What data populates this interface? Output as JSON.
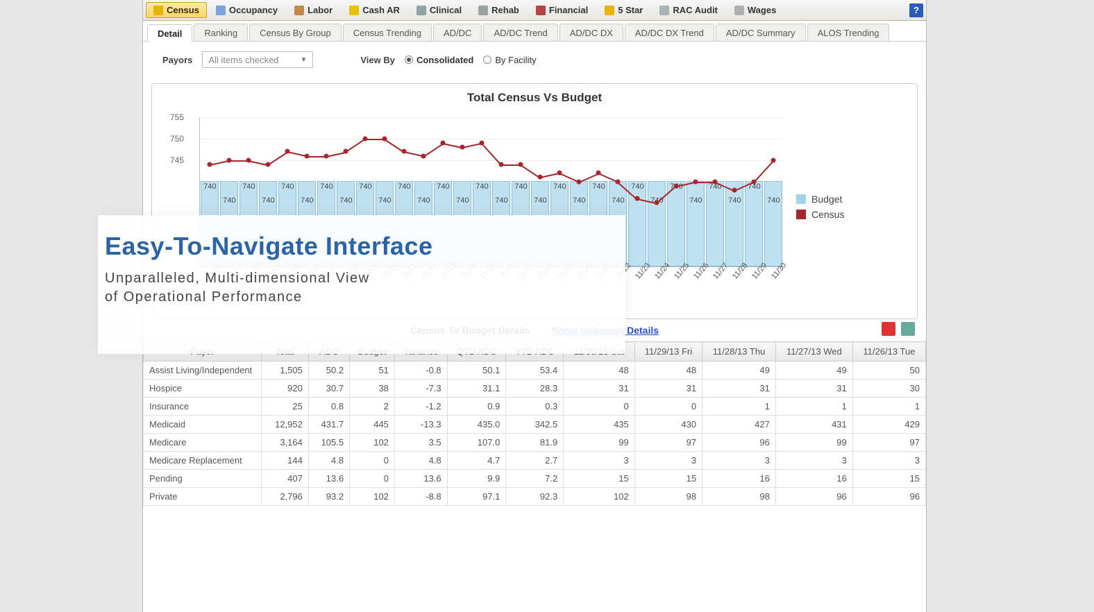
{
  "toolbar": {
    "items": [
      {
        "label": "Census",
        "active": true,
        "icon": "census"
      },
      {
        "label": "Occupancy",
        "icon": "occ"
      },
      {
        "label": "Labor",
        "icon": "labor"
      },
      {
        "label": "Cash AR",
        "icon": "cash"
      },
      {
        "label": "Clinical",
        "icon": "clinical"
      },
      {
        "label": "Rehab",
        "icon": "rehab"
      },
      {
        "label": "Financial",
        "icon": "fin"
      },
      {
        "label": "5 Star",
        "icon": "star"
      },
      {
        "label": "RAC Audit",
        "icon": "rac"
      },
      {
        "label": "Wages",
        "icon": "wages"
      }
    ]
  },
  "subtabs": [
    {
      "label": "Detail",
      "active": true
    },
    {
      "label": "Ranking"
    },
    {
      "label": "Census By Group"
    },
    {
      "label": "Census Trending"
    },
    {
      "label": "AD/DC"
    },
    {
      "label": "AD/DC Trend"
    },
    {
      "label": "AD/DC DX"
    },
    {
      "label": "AD/DC DX Trend"
    },
    {
      "label": "AD/DC Summary"
    },
    {
      "label": "ALOS Trending"
    }
  ],
  "filters": {
    "payors_label": "Payors",
    "payors_value": "All items checked",
    "viewby_label": "View By",
    "radio_consolidated": "Consolidated",
    "radio_byfacility": "By Facility",
    "selected": "consolidated"
  },
  "overlay": {
    "title": "Easy-To-Navigate Interface",
    "sub1": "Unparalleled, Multi-dimensional View",
    "sub2": "of Operational Performance"
  },
  "chart_data": {
    "type": "bar",
    "title": "Total Census Vs Budget",
    "ylim": [
      720,
      755
    ],
    "yticks": [
      745,
      750,
      755
    ],
    "categories": [
      "11/01",
      "11/02",
      "11/03",
      "11/04",
      "11/05",
      "11/06",
      "11/07",
      "11/08",
      "11/09",
      "11/10",
      "11/11",
      "11/12",
      "11/13",
      "11/14",
      "11/15",
      "11/16",
      "11/17",
      "11/18",
      "11/19",
      "11/20",
      "11/21",
      "11/22",
      "11/23",
      "11/24",
      "11/25",
      "11/26",
      "11/27",
      "11/28",
      "11/29",
      "11/30"
    ],
    "series": [
      {
        "name": "Budget",
        "values": [
          740,
          740,
          740,
          740,
          740,
          740,
          740,
          740,
          740,
          740,
          740,
          740,
          740,
          740,
          740,
          740,
          740,
          740,
          740,
          740,
          740,
          740,
          740,
          740,
          740,
          740,
          740,
          740,
          740,
          740
        ]
      },
      {
        "name": "Census",
        "values": [
          744,
          745,
          745,
          744,
          747,
          746,
          746,
          747,
          750,
          750,
          747,
          746,
          749,
          748,
          749,
          744,
          744,
          741,
          742,
          740,
          742,
          740,
          736,
          735,
          739,
          740,
          740,
          738,
          740,
          745
        ]
      }
    ],
    "legend": [
      "Budget",
      "Census"
    ],
    "bar_label": "740"
  },
  "table": {
    "title": "Census To Budget Details",
    "link_text": "Show Unknown Details",
    "columns": [
      "Payor",
      "Total",
      "ADC",
      "Budget",
      "Variance",
      "QTD ADC",
      "YTD ADC",
      "11/30/13 Sat",
      "11/29/13 Fri",
      "11/28/13 Thu",
      "11/27/13 Wed",
      "11/26/13 Tue"
    ],
    "rows": [
      {
        "payor": "Assist Living/Independent",
        "cells": [
          "1,505",
          "50.2",
          "51",
          "-0.8",
          "50.1",
          "53.4",
          "48",
          "48",
          "49",
          "49",
          "50"
        ]
      },
      {
        "payor": "Hospice",
        "cells": [
          "920",
          "30.7",
          "38",
          "-7.3",
          "31.1",
          "28.3",
          "31",
          "31",
          "31",
          "31",
          "30"
        ]
      },
      {
        "payor": "Insurance",
        "cells": [
          "25",
          "0.8",
          "2",
          "-1.2",
          "0.9",
          "0.3",
          "0",
          "0",
          "1",
          "1",
          "1"
        ]
      },
      {
        "payor": "Medicaid",
        "cells": [
          "12,952",
          "431.7",
          "445",
          "-13.3",
          "435.0",
          "342.5",
          "435",
          "430",
          "427",
          "431",
          "429"
        ]
      },
      {
        "payor": "Medicare",
        "cells": [
          "3,164",
          "105.5",
          "102",
          "3.5",
          "107.0",
          "81.9",
          "99",
          "97",
          "96",
          "99",
          "97"
        ]
      },
      {
        "payor": "Medicare Replacement",
        "cells": [
          "144",
          "4.8",
          "0",
          "4.8",
          "4.7",
          "2.7",
          "3",
          "3",
          "3",
          "3",
          "3"
        ]
      },
      {
        "payor": "Pending",
        "cells": [
          "407",
          "13.6",
          "0",
          "13.6",
          "9.9",
          "7.2",
          "15",
          "15",
          "16",
          "16",
          "15"
        ]
      },
      {
        "payor": "Private",
        "cells": [
          "2,796",
          "93.2",
          "102",
          "-8.8",
          "97.1",
          "92.3",
          "102",
          "98",
          "98",
          "96",
          "96"
        ]
      }
    ]
  }
}
